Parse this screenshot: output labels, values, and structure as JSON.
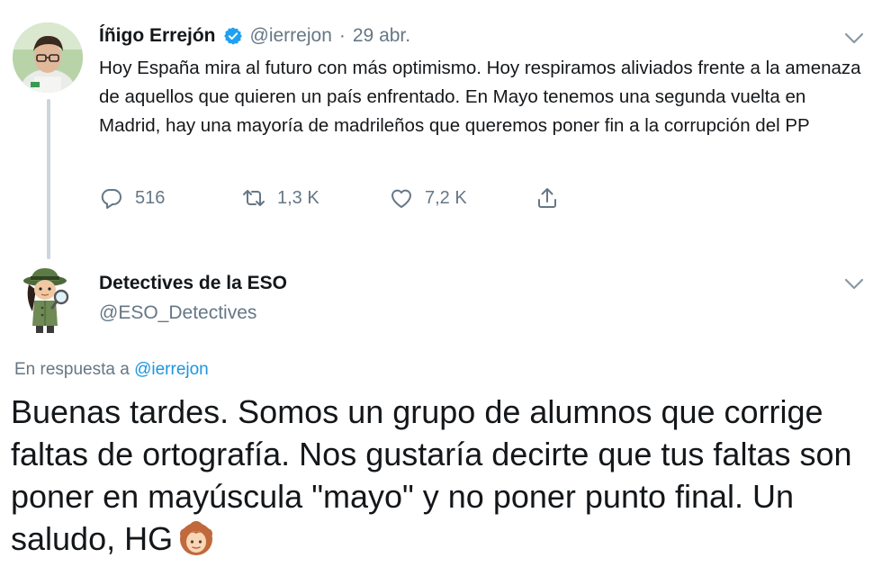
{
  "tweet1": {
    "name": "Íñigo Errejón",
    "handle": "@ierrejon",
    "separator": "·",
    "date": "29 abr.",
    "text": "Hoy España mira al futuro con más optimismo. Hoy respiramos aliviados frente a la amenaza de aquellos que quieren un país enfrentado. En Mayo tenemos una segunda vuelta en Madrid, hay una mayoría de madrileños que queremos poner fin a la corrupción del PP",
    "replies": "516",
    "retweets": "1,3 K",
    "likes": "7,2 K"
  },
  "tweet2": {
    "name": "Detectives de la ESO",
    "handle": "@ESO_Detectives",
    "reply_prefix": "En respuesta a",
    "reply_mention": "@ierrejon",
    "text": "Buenas tardes. Somos un grupo de alumnos que corrige faltas de ortografía. Nos gustaría decirte que tus faltas son poner en mayúscula \"mayo\" y no poner punto final. Un saludo, HG",
    "emoji": "woman-face-emoji"
  },
  "colors": {
    "text": "#14171a",
    "secondary": "#657786",
    "link": "#1b95e0",
    "verified": "#1da1f2",
    "thread_line": "#cbd5dc"
  },
  "icons": [
    "verified-icon",
    "chevron-down-icon",
    "reply-icon",
    "retweet-icon",
    "like-icon",
    "share-icon"
  ]
}
